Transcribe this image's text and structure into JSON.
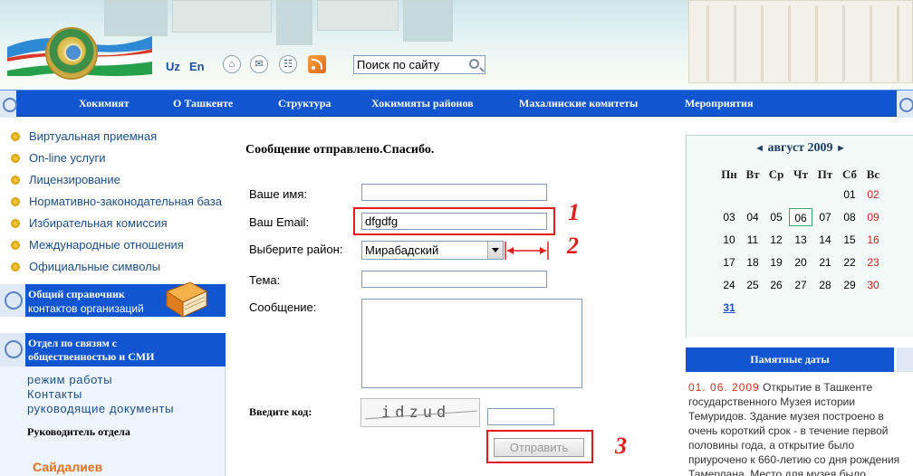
{
  "header": {
    "lang_uz": "Uz",
    "lang_en": "En",
    "search_placeholder": "Поиск по сайту"
  },
  "nav": [
    "Хокимият",
    "О Ташкенте",
    "Структура",
    "Хокимияты районов",
    "Махалинские комитеты",
    "Мероприятия"
  ],
  "sidebar": {
    "links": [
      "Виртуальная приемная",
      "On-line услуги",
      "Лицензирование",
      "Нормативно-законодательная база",
      "Избирательная комиссия",
      "Международные отношения",
      "Официальные символы"
    ],
    "directory": {
      "title": "Общий справочник",
      "subtitle": "контактов организаций"
    },
    "media_dept": {
      "title_line1": "Отдел по связям с",
      "title_line2": "общественностью и СМИ"
    },
    "dept_links": [
      "режим работы",
      "Контакты",
      "руководящие документы"
    ],
    "head_label": "Руководитель отдела",
    "head_name": "Сайдалиев"
  },
  "form": {
    "message": "Сообщение отправлено.Спасибо.",
    "name_label": "Ваше имя:",
    "name_value": "",
    "email_label": "Ваш Email:",
    "email_value": "dfgdfg",
    "district_label": "Выберите район:",
    "district_value": "Мирабадский",
    "subject_label": "Тема:",
    "subject_value": "",
    "message_label": "Сообщение:",
    "message_value": "",
    "code_label": "Введите код:",
    "captcha_text": "idzud",
    "code_value": "",
    "submit_label": "Отправить",
    "annotations": [
      "1",
      "2",
      "3"
    ]
  },
  "calendar": {
    "month_label": "август 2009",
    "prev": "◄",
    "next": "►",
    "weekdays": [
      "Пн",
      "Вт",
      "Ср",
      "Чт",
      "Пт",
      "Сб",
      "Вс"
    ],
    "weeks": [
      [
        "",
        "",
        "",
        "",
        "",
        "01",
        "02"
      ],
      [
        "03",
        "04",
        "05",
        "06",
        "07",
        "08",
        "09"
      ],
      [
        "10",
        "11",
        "12",
        "13",
        "14",
        "15",
        "16"
      ],
      [
        "17",
        "18",
        "19",
        "20",
        "21",
        "22",
        "23"
      ],
      [
        "24",
        "25",
        "26",
        "27",
        "28",
        "29",
        "30"
      ],
      [
        "31",
        "",
        "",
        "",
        "",
        "",
        ""
      ]
    ],
    "today": "06",
    "linked_day": "31"
  },
  "memorable": {
    "title": "Памятные даты",
    "date": "01. 06. 2009",
    "text": "Открытие в Ташкенте государственного Музея истории Темуридов. Здание музея построено в очень короткий срок - в течение первой половины года, а открытие было приурочено к 660-летию со дня рождения Тамерлана. Место для музея было"
  },
  "colors": {
    "nav_blue": "#1155d1",
    "link_blue": "#1a4f8c",
    "annotation_red": "#e31b1b",
    "weekend_red": "#d21a1a"
  }
}
